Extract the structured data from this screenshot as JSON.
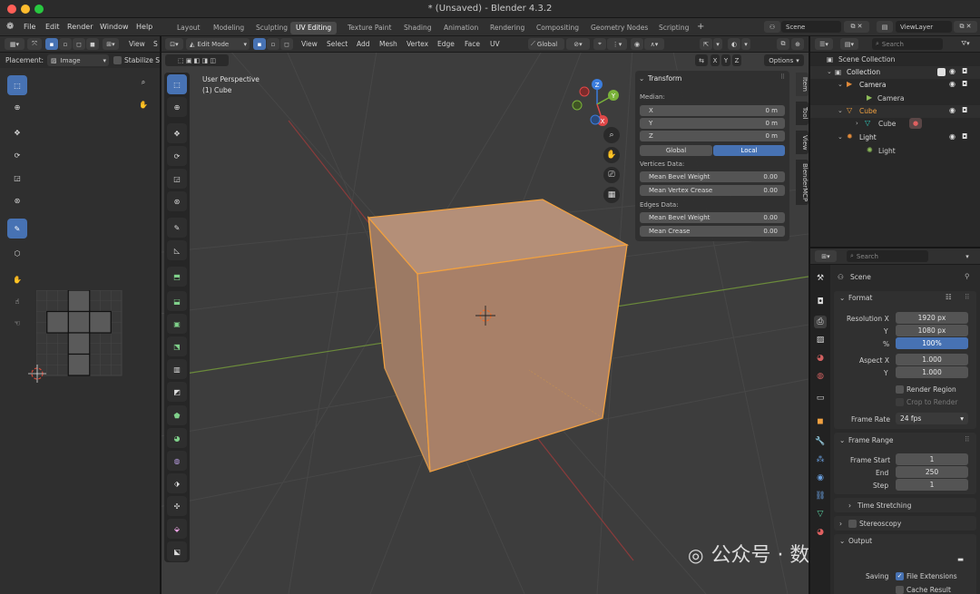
{
  "window": {
    "title": "* (Unsaved) - Blender 4.3.2"
  },
  "menu": {
    "file": "File",
    "edit": "Edit",
    "render": "Render",
    "window": "Window",
    "help": "Help"
  },
  "workspaces": [
    "Layout",
    "Modeling",
    "Sculpting",
    "UV Editing",
    "Texture Paint",
    "Shading",
    "Animation",
    "Rendering",
    "Compositing",
    "Geometry Nodes",
    "Scripting"
  ],
  "active_workspace": "UV Editing",
  "scene_selector": {
    "value": "Scene"
  },
  "viewlayer_selector": {
    "value": "ViewLayer"
  },
  "uv_editor": {
    "view_menu": "View",
    "placement_label": "Placement:",
    "placement_value": "Image",
    "stabilize_label": "Stabilize S"
  },
  "viewport_header": {
    "mode": "Edit Mode",
    "menus": [
      "View",
      "Select",
      "Add",
      "Mesh",
      "Vertex",
      "Edge",
      "Face",
      "UV"
    ],
    "transform_orientation": "Global",
    "axes": [
      "X",
      "Y",
      "Z"
    ],
    "options": "Options"
  },
  "viewport": {
    "perspective_label": "User Perspective",
    "object_label": "(1) Cube",
    "gizmo_axes": [
      "X",
      "Y",
      "Z"
    ]
  },
  "n_panel": {
    "header": "Transform",
    "median_label": "Median:",
    "median": [
      {
        "axis": "X",
        "value": "0 m"
      },
      {
        "axis": "Y",
        "value": "0 m"
      },
      {
        "axis": "Z",
        "value": "0 m"
      }
    ],
    "space_global": "Global",
    "space_local": "Local",
    "vertices_data_label": "Vertices Data:",
    "mean_bevel_weight_v": {
      "label": "Mean Bevel Weight",
      "value": "0.00"
    },
    "mean_vertex_crease": {
      "label": "Mean Vertex Crease",
      "value": "0.00"
    },
    "edges_data_label": "Edges Data:",
    "mean_bevel_weight_e": {
      "label": "Mean Bevel Weight",
      "value": "0.00"
    },
    "mean_crease": {
      "label": "Mean Crease",
      "value": "0.00"
    },
    "tabs": [
      "Item",
      "Tool",
      "View",
      "BlenderMCP"
    ]
  },
  "outliner": {
    "search_placeholder": "Search",
    "scene_collection": "Scene Collection",
    "collection": "Collection",
    "camera": "Camera",
    "camera_data": "Camera",
    "cube": "Cube",
    "cube_data": "Cube",
    "light": "Light",
    "light_data": "Light"
  },
  "properties": {
    "search_placeholder": "Search",
    "context": "Scene",
    "format_header": "Format",
    "resolution_x_label": "Resolution X",
    "resolution_x": "1920 px",
    "resolution_y_label": "Y",
    "resolution_y": "1080 px",
    "percent_label": "%",
    "percent": "100%",
    "percent_fraction": 1.0,
    "aspect_x_label": "Aspect X",
    "aspect_x": "1.000",
    "aspect_y_label": "Y",
    "aspect_y": "1.000",
    "render_region": "Render Region",
    "crop_to_render": "Crop to Render",
    "frame_rate_label": "Frame Rate",
    "frame_rate": "24 fps",
    "frame_range_header": "Frame Range",
    "frame_start_label": "Frame Start",
    "frame_start": "1",
    "end_label": "End",
    "end": "250",
    "step_label": "Step",
    "step": "1",
    "time_stretching": "Time Stretching",
    "stereoscopy": "Stereoscopy",
    "output_header": "Output",
    "saving_label": "Saving",
    "file_extensions": "File Extensions",
    "cache_result": "Cache Result"
  },
  "watermark": {
    "text": "公众号 · 数字共生"
  },
  "colors": {
    "selection_orange": "#f0a040",
    "active_blue": "#4772b3",
    "x_axis": "#e04848",
    "y_axis": "#7ab23a",
    "z_axis": "#3b7ddd"
  }
}
